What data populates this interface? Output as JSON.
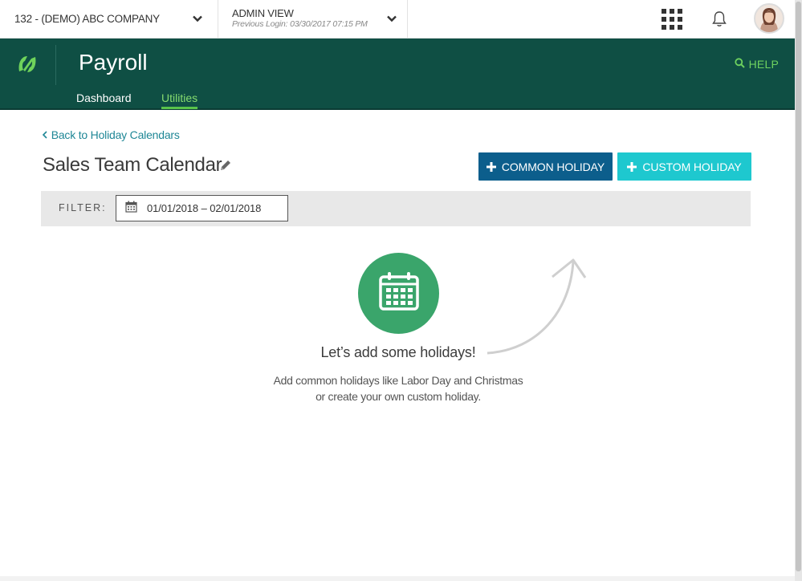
{
  "topbar": {
    "company": "132 - (DEMO) ABC COMPANY",
    "view_title": "ADMIN VIEW",
    "view_subtitle": "Previous Login: 03/30/2017 07:15 PM"
  },
  "appbar": {
    "title": "Payroll",
    "help": "HELP",
    "tabs": [
      {
        "label": "Dashboard",
        "active": false
      },
      {
        "label": "Utilities",
        "active": true
      }
    ]
  },
  "content": {
    "back_link": "Back to Holiday Calendars",
    "title": "Sales Team Calendar",
    "buttons": {
      "common": "COMMON HOLIDAY",
      "custom": "CUSTOM HOLIDAY"
    },
    "filter": {
      "label": "FILTER:",
      "date_range": "01/01/2018 –  02/01/2018"
    },
    "empty_state": {
      "heading": "Let’s add some holidays!",
      "line1": "Add common holidays like Labor Day and Christmas",
      "line2": "or create your own custom holiday."
    }
  },
  "icons": [
    "chevron-down-icon",
    "apps-grid-icon",
    "bell-icon",
    "avatar",
    "logo-icon",
    "search-icon",
    "chevron-left-icon",
    "pencil-icon",
    "plus-icon",
    "calendar-icon",
    "curved-arrow"
  ],
  "colors": {
    "header_green": "#0f4f44",
    "accent_green": "#59c44b",
    "link_teal": "#1f8796",
    "btn_common": "#0c5e8c",
    "btn_custom": "#1ec8cf",
    "empty_circle": "#3aa56b"
  }
}
